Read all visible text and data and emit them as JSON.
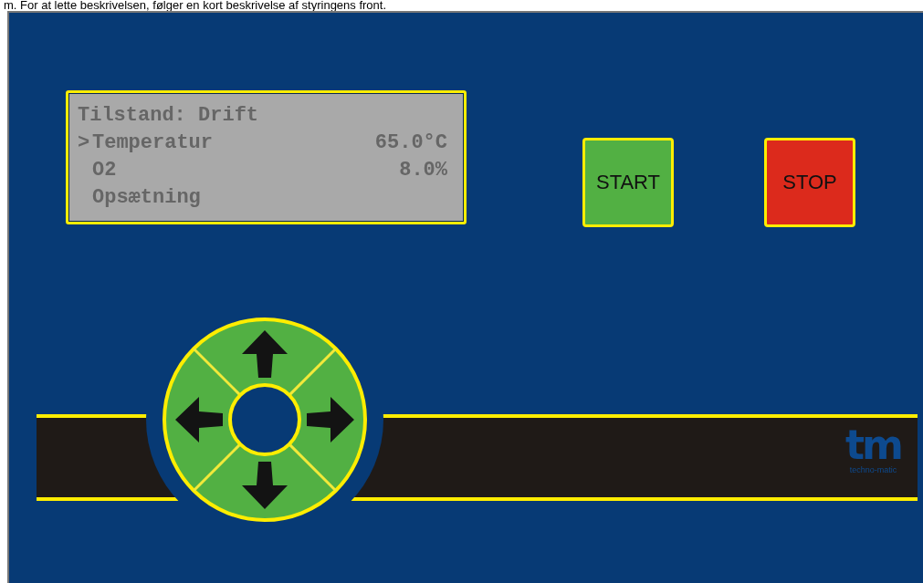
{
  "caption": "m. For at lette beskrivelsen, følger en kort beskrivelse af styringens front.",
  "display": {
    "status": "Tilstand: Drift",
    "cursor": ">",
    "items": [
      {
        "label": "Temperatur",
        "value": "65.0°C",
        "selected": true
      },
      {
        "label": "O2",
        "value": "8.0%",
        "selected": false
      },
      {
        "label": "Opsætning",
        "value": "",
        "selected": false
      }
    ]
  },
  "buttons": [
    {
      "label": "START",
      "kind": "start"
    },
    {
      "label": "STOP",
      "kind": "stop"
    }
  ],
  "logo": {
    "mark": "tm",
    "name": "techno-matic"
  }
}
